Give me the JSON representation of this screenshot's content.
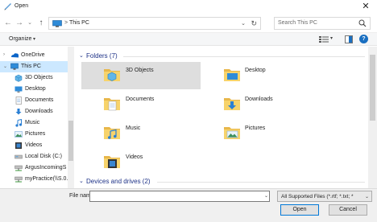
{
  "window": {
    "title": "Open",
    "close_icon": "close-icon"
  },
  "nav": {
    "address_text": "This PC",
    "address_sep": ">",
    "search_placeholder": "Search This PC"
  },
  "toolbar": {
    "organize_label": "Organize"
  },
  "sidebar": {
    "items": [
      {
        "label": "OneDrive",
        "icon": "onedrive-icon",
        "expander": ">",
        "selected": false
      },
      {
        "label": "This PC",
        "icon": "pc-icon",
        "expander": "v",
        "selected": true
      },
      {
        "label": "3D Objects",
        "icon": "3d-objects-icon",
        "expander": "",
        "selected": false
      },
      {
        "label": "Desktop",
        "icon": "desktop-icon",
        "expander": "",
        "selected": false
      },
      {
        "label": "Documents",
        "icon": "documents-icon",
        "expander": "",
        "selected": false
      },
      {
        "label": "Downloads",
        "icon": "downloads-icon",
        "expander": "",
        "selected": false
      },
      {
        "label": "Music",
        "icon": "music-icon",
        "expander": "",
        "selected": false
      },
      {
        "label": "Pictures",
        "icon": "pictures-icon",
        "expander": "",
        "selected": false
      },
      {
        "label": "Videos",
        "icon": "videos-icon",
        "expander": "",
        "selected": false
      },
      {
        "label": "Local Disk (C:)",
        "icon": "local-disk-icon",
        "expander": "",
        "selected": false
      },
      {
        "label": "ArgusIncomingS",
        "icon": "network-drive-icon",
        "expander": "",
        "selected": false
      },
      {
        "label": "myPractice(\\\\S.0.",
        "icon": "network-drive-icon",
        "expander": "",
        "selected": false
      }
    ]
  },
  "main": {
    "folders_header": "Folders (7)",
    "drives_header": "Devices and drives (2)",
    "folders": [
      {
        "label": "3D Objects",
        "icon": "3d-objects-icon",
        "selected": true
      },
      {
        "label": "Desktop",
        "icon": "desktop-icon",
        "selected": false
      },
      {
        "label": "Documents",
        "icon": "documents-icon",
        "selected": false
      },
      {
        "label": "Downloads",
        "icon": "downloads-icon",
        "selected": false
      },
      {
        "label": "Music",
        "icon": "music-icon",
        "selected": false
      },
      {
        "label": "Pictures",
        "icon": "pictures-icon",
        "selected": false
      },
      {
        "label": "Videos",
        "icon": "videos-icon",
        "selected": false
      }
    ]
  },
  "bottom": {
    "filename_label": "File name:",
    "filename_value": "",
    "filter_label": "All Supported Files (*.rtf; *.txt; *",
    "open_label": "Open",
    "cancel_label": "Cancel"
  }
}
